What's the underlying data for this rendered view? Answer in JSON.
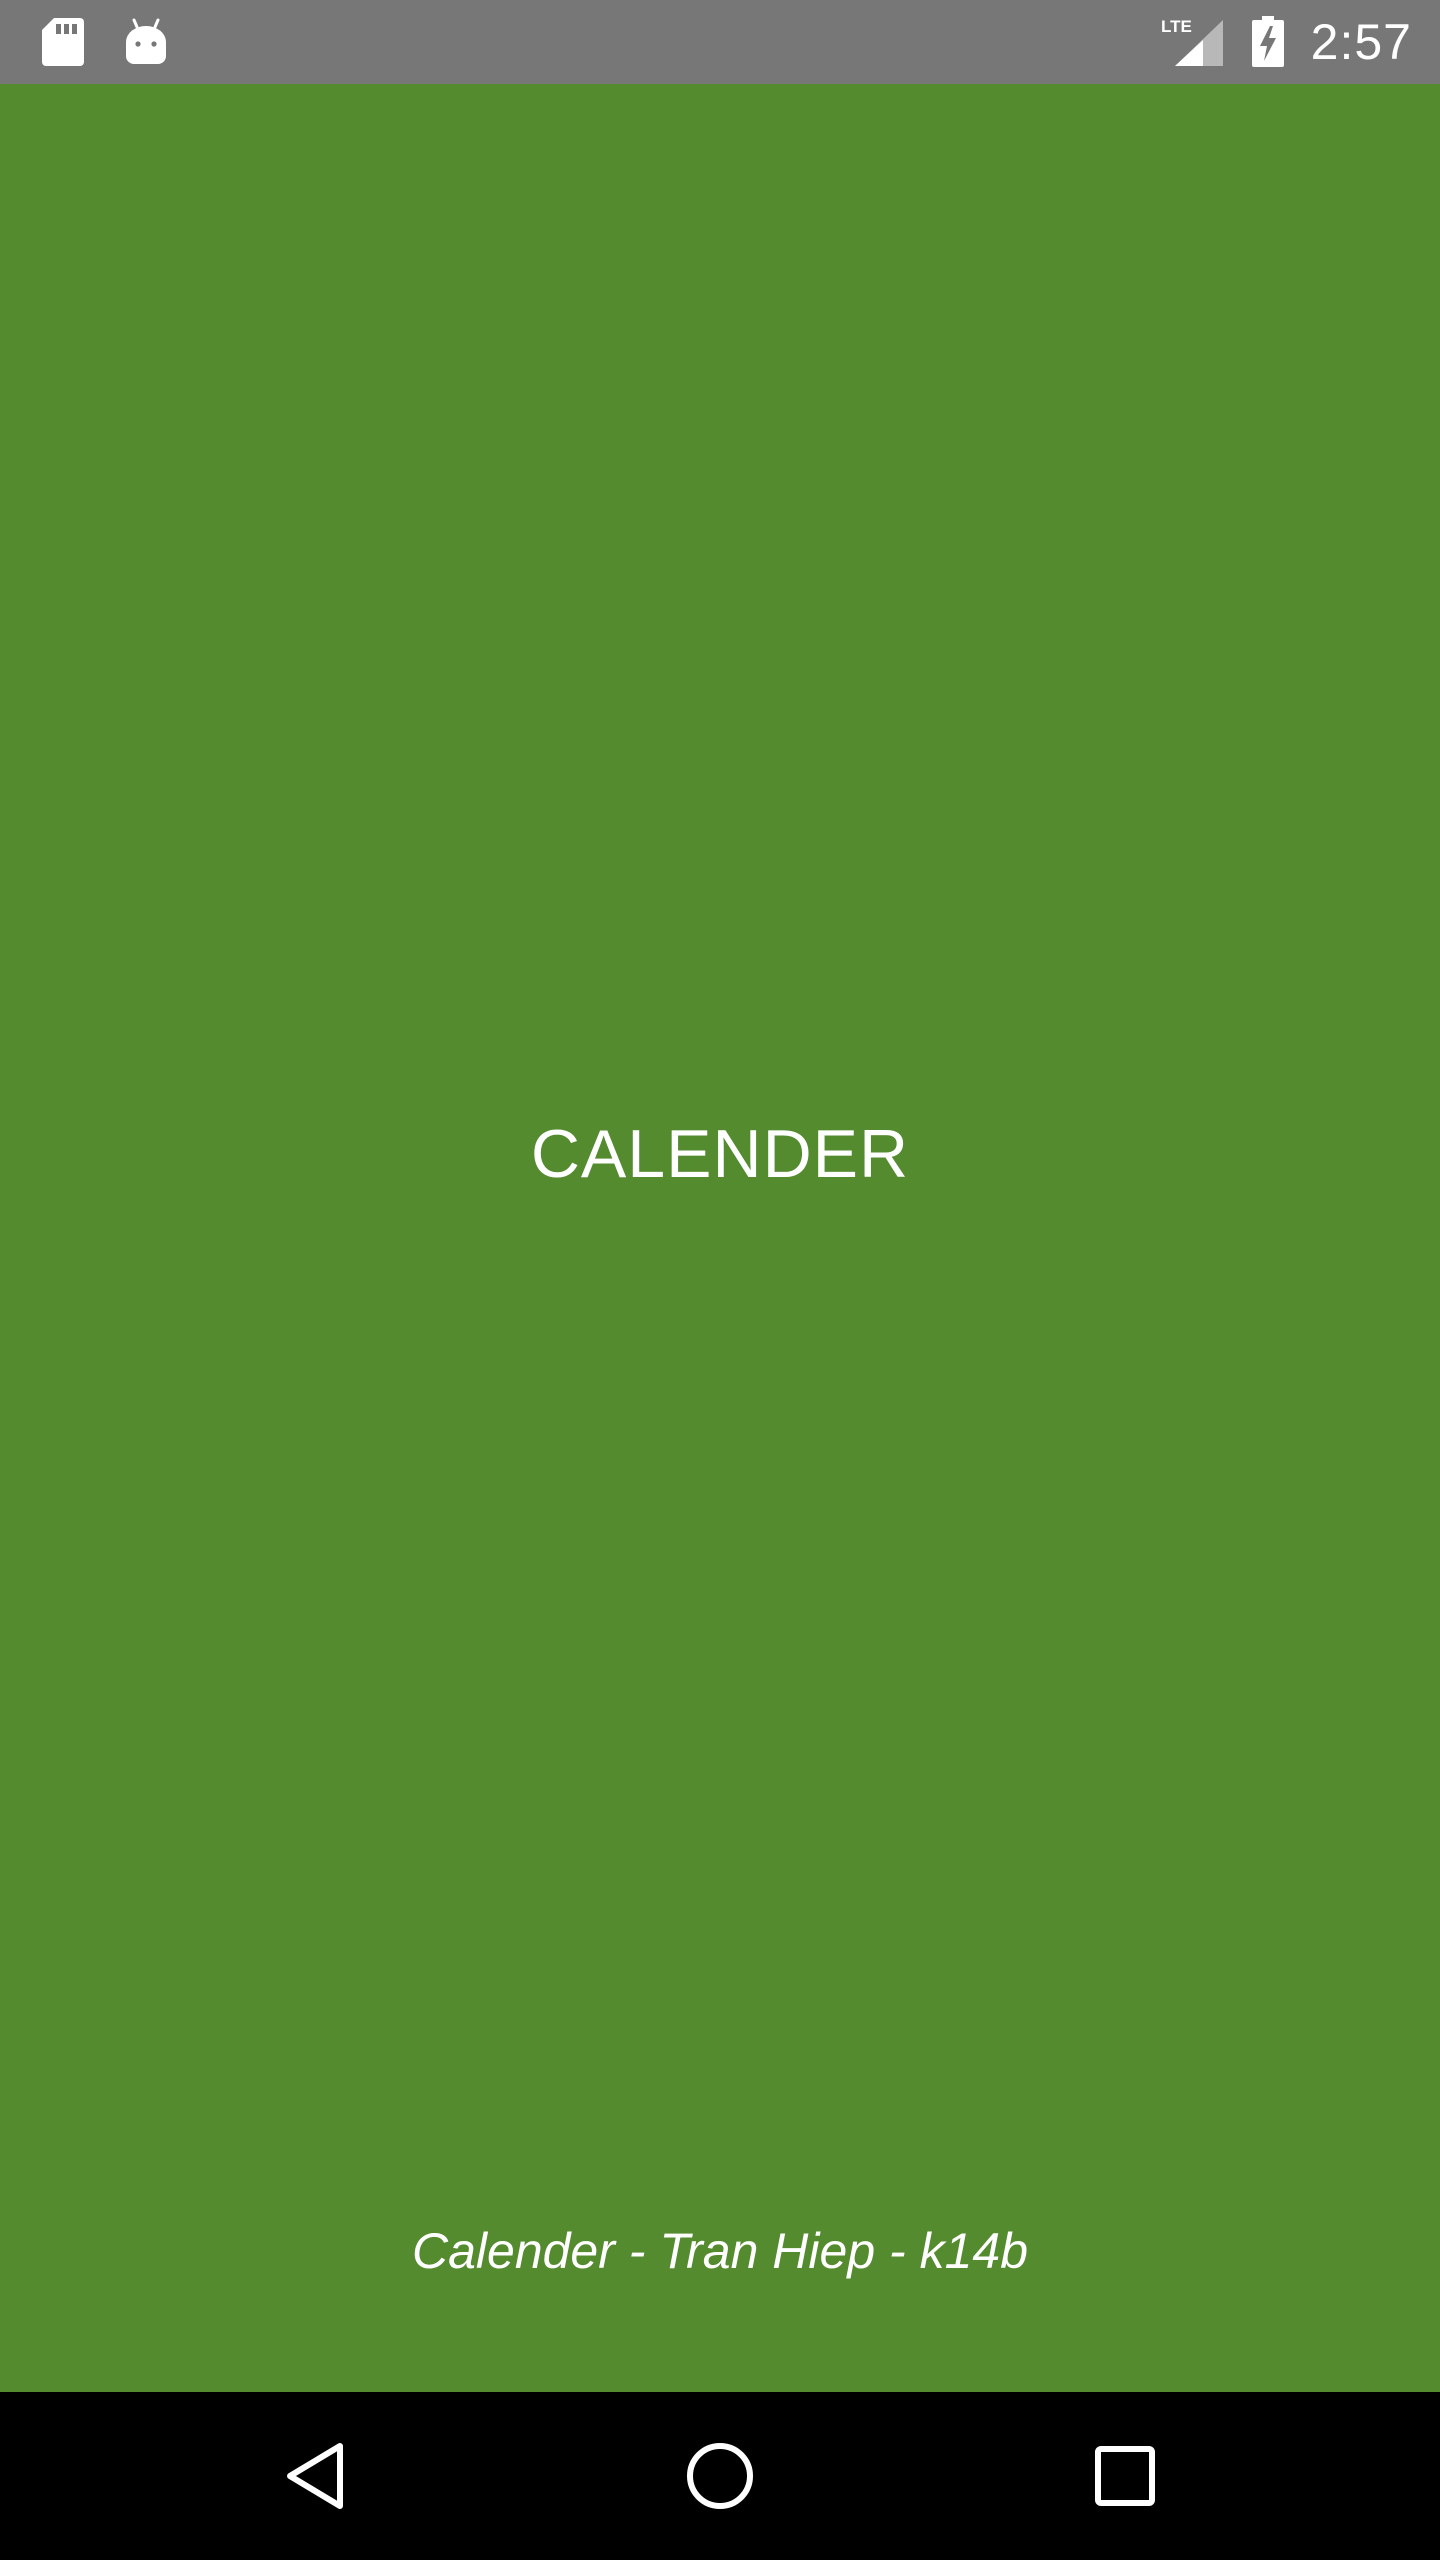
{
  "status_bar": {
    "time": "2:57",
    "network_label": "LTE",
    "icons": [
      "sd-card-icon",
      "android-icon",
      "lte-signal-icon",
      "battery-charging-icon"
    ],
    "background_color": "#777777"
  },
  "main": {
    "title": "CALENDER",
    "footer_credit": "Calender - Tran Hiep - k14b",
    "background_color": "#558b2f"
  },
  "nav_bar": {
    "buttons": [
      "back-icon",
      "home-icon",
      "recents-icon"
    ],
    "background_color": "#000000"
  }
}
